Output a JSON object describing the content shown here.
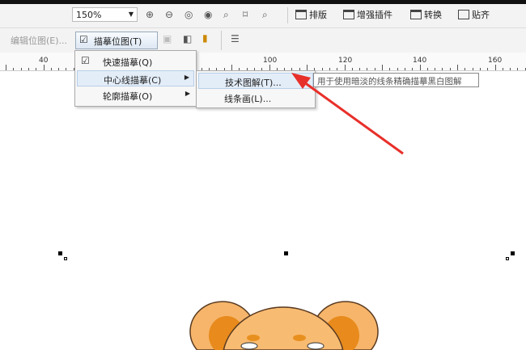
{
  "toolbar": {
    "zoom": "150%",
    "buttons": [
      "排版",
      "增强插件",
      "转换",
      "贴齐"
    ]
  },
  "bitmap_bar": {
    "edit_bitmap": "编辑位图(E)...",
    "trace_bitmap": "描摹位图(T)"
  },
  "ruler": {
    "labels": [
      "40",
      "100",
      "120",
      "140",
      "160"
    ]
  },
  "menu": {
    "items": [
      {
        "label": "快速描摹(Q)"
      },
      {
        "label": "中心线描摹(C)"
      },
      {
        "label": "轮廓描摹(O)"
      }
    ]
  },
  "submenu": {
    "items": [
      {
        "label": "技术图解(T)..."
      },
      {
        "label": "线条画(L)..."
      }
    ]
  },
  "tooltip": "用于使用暗淡的线条精确描摹黑白图解",
  "colors": {
    "arrow": "#e8302a",
    "highlight": "#e3edf8"
  }
}
